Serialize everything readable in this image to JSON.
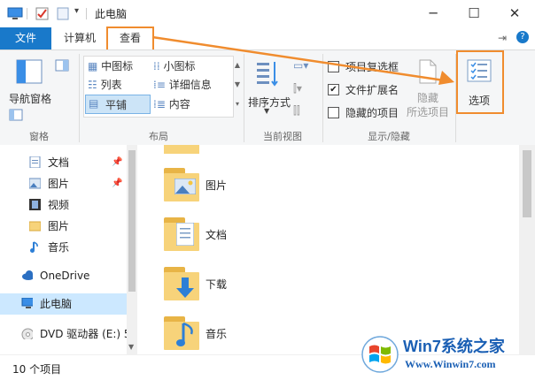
{
  "window": {
    "title": "此电脑"
  },
  "tabs": {
    "file": "文件",
    "computer": "计算机",
    "view": "查看"
  },
  "ribbon": {
    "pane_group": {
      "nav_pane_label": "导航窗格",
      "group_label": "窗格"
    },
    "layout_group": {
      "items": [
        "中图标",
        "小图标",
        "列表",
        "详细信息",
        "平铺",
        "内容"
      ],
      "selected": "平铺",
      "group_label": "布局"
    },
    "current_view_group": {
      "sort_label": "排序方式",
      "group_label": "当前视图"
    },
    "show_hide_group": {
      "item_checkbox": {
        "label": "项目复选框",
        "checked": false
      },
      "file_ext": {
        "label": "文件扩展名",
        "checked": true
      },
      "hidden_items": {
        "label": "隐藏的项目",
        "checked": false
      },
      "hide_label": "隐藏",
      "hide_sub_label": "所选项目",
      "group_label": "显示/隐藏"
    },
    "options_label": "选项"
  },
  "nav": {
    "items": [
      {
        "label": "文档",
        "icon": "document-icon"
      },
      {
        "label": "图片",
        "icon": "picture-icon"
      },
      {
        "label": "视频",
        "icon": "video-icon"
      },
      {
        "label": "图片",
        "icon": "folder-icon"
      },
      {
        "label": "音乐",
        "icon": "music-icon"
      },
      {
        "label": "OneDrive",
        "icon": "cloud-icon"
      },
      {
        "label": "此电脑",
        "icon": "computer-icon"
      },
      {
        "label": "DVD 驱动器 (E:) 5",
        "icon": "dvd-icon"
      }
    ]
  },
  "content": {
    "folders": [
      {
        "label": "图片"
      },
      {
        "label": "文档"
      },
      {
        "label": "下载"
      },
      {
        "label": "音乐"
      }
    ]
  },
  "status": {
    "count": "10 个项目"
  },
  "watermark": {
    "brand": "Win7系统之家",
    "url": "Www.Winwin7.com"
  },
  "colors": {
    "accent": "#1979ca",
    "highlight": "#f08c2e",
    "folder": "#f7d37a"
  }
}
